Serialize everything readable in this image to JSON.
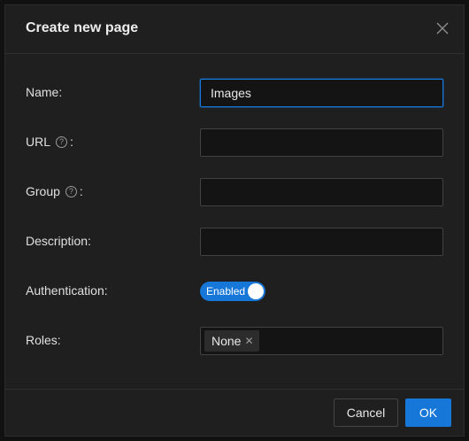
{
  "dialog": {
    "title": "Create new page"
  },
  "form": {
    "name_label": "Name:",
    "name_value": "Images",
    "url_label": "URL",
    "url_colon": ":",
    "url_value": "",
    "group_label": "Group",
    "group_colon": ":",
    "group_value": "",
    "description_label": "Description:",
    "description_value": "",
    "auth_label": "Authentication:",
    "auth_toggle_text": "Enabled",
    "auth_enabled": true,
    "roles_label": "Roles:",
    "roles_tags": [
      "None"
    ]
  },
  "footer": {
    "cancel_label": "Cancel",
    "ok_label": "OK"
  },
  "icons": {
    "close": "close-icon",
    "help": "question-circle-icon",
    "tag_close": "close-icon"
  },
  "colors": {
    "primary": "#1677d9",
    "dialog_bg": "#1f1f1f",
    "input_bg": "#141414"
  }
}
